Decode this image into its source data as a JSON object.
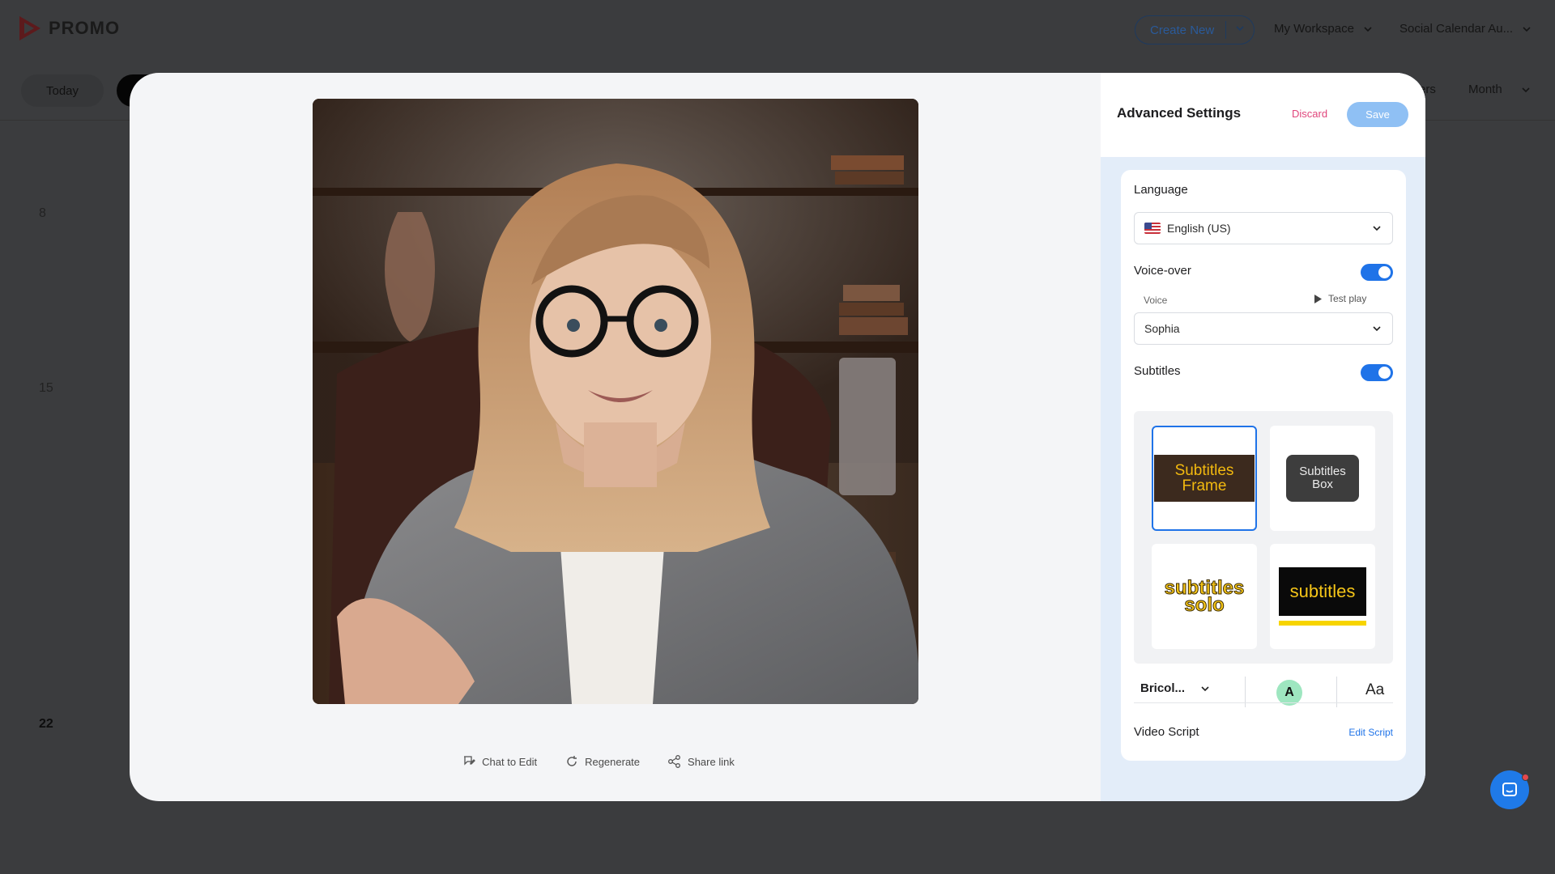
{
  "app": {
    "brand": "PROMO"
  },
  "topbar": {
    "create_new": "Create New",
    "workspace": "My Workspace",
    "calendar": "Social Calendar Au..."
  },
  "subbar": {
    "today": "Today",
    "filters_partial": "ers",
    "view": "Month"
  },
  "calendar": {
    "days": [
      "8",
      "15",
      "22"
    ]
  },
  "video": {
    "actions": {
      "chat": "Chat to Edit",
      "regenerate": "Regenerate",
      "share": "Share link"
    }
  },
  "settings": {
    "title": "Advanced Settings",
    "discard": "Discard",
    "save": "Save",
    "language_label": "Language",
    "language_value": "English (US)",
    "voiceover_label": "Voice-over",
    "voiceover_on": true,
    "voice_label": "Voice",
    "test_play": "Test play",
    "voice_value": "Sophia",
    "subtitles_label": "Subtitles",
    "subtitles_on": true,
    "styles": [
      {
        "line1": "Subtitles",
        "line2": "Frame",
        "selected": true
      },
      {
        "line1": "Subtitles",
        "line2": "Box"
      },
      {
        "line1": "subtitles",
        "line2": "solo"
      },
      {
        "line1": "subtitles"
      }
    ],
    "font_value": "Bricol...",
    "color_letter": "A",
    "text_case": "Aa",
    "script_label": "Video Script",
    "edit_script": "Edit Script"
  },
  "colors": {
    "accent": "#1f73e8",
    "discard": "#e0457b",
    "save_disabled": "#8fc0f4",
    "panel_bg": "#e3edf9",
    "subtitle_yellow": "#f5c518",
    "color_swatch": "#9ee6c0"
  }
}
